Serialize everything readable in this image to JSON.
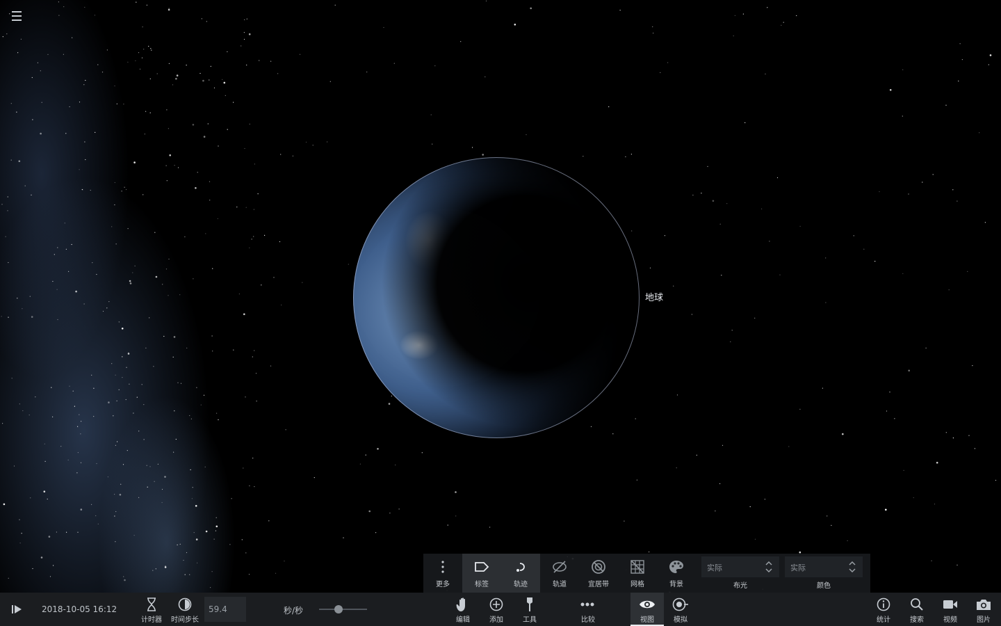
{
  "app": {
    "menu_icon": "hamburger-menu-icon"
  },
  "scene": {
    "earth_label": "地球"
  },
  "view_toolbar": {
    "items": [
      {
        "label": "更多",
        "icon": "more-vertical-icon"
      },
      {
        "label": "标签",
        "icon": "label-tag-icon"
      },
      {
        "label": "轨迹",
        "icon": "trail-icon"
      },
      {
        "label": "轨道",
        "icon": "orbit-hidden-icon"
      },
      {
        "label": "宜居带",
        "icon": "habitable-zone-disabled-icon"
      },
      {
        "label": "网格",
        "icon": "grid-disabled-icon"
      },
      {
        "label": "背景",
        "icon": "palette-icon"
      }
    ],
    "lighting": {
      "value": "实际",
      "label": "布光"
    },
    "color": {
      "value": "实际",
      "label": "颜色"
    }
  },
  "bottom_bar": {
    "play_icon": "play-icon",
    "datetime": "2018-10-05 16:12",
    "timer_label": "计时器",
    "timestep_label": "时间步长",
    "rate_value": "59.4",
    "rate_unit": "秒/秒",
    "rate_slider_fraction": 0.41,
    "center_tools": [
      {
        "label": "编辑",
        "icon": "hand-edit-icon"
      },
      {
        "label": "添加",
        "icon": "plus-circle-icon"
      },
      {
        "label": "工具",
        "icon": "tool-icon"
      },
      {
        "label": "比较",
        "icon": "compare-dots-icon"
      },
      {
        "label": "视图",
        "icon": "eye-icon",
        "active": true
      },
      {
        "label": "模拟",
        "icon": "simulate-icon"
      }
    ],
    "right_tools": [
      {
        "label": "统计",
        "icon": "info-icon"
      },
      {
        "label": "搜索",
        "icon": "search-icon"
      },
      {
        "label": "视频",
        "icon": "video-camera-icon"
      },
      {
        "label": "图片",
        "icon": "photo-camera-icon"
      }
    ]
  }
}
